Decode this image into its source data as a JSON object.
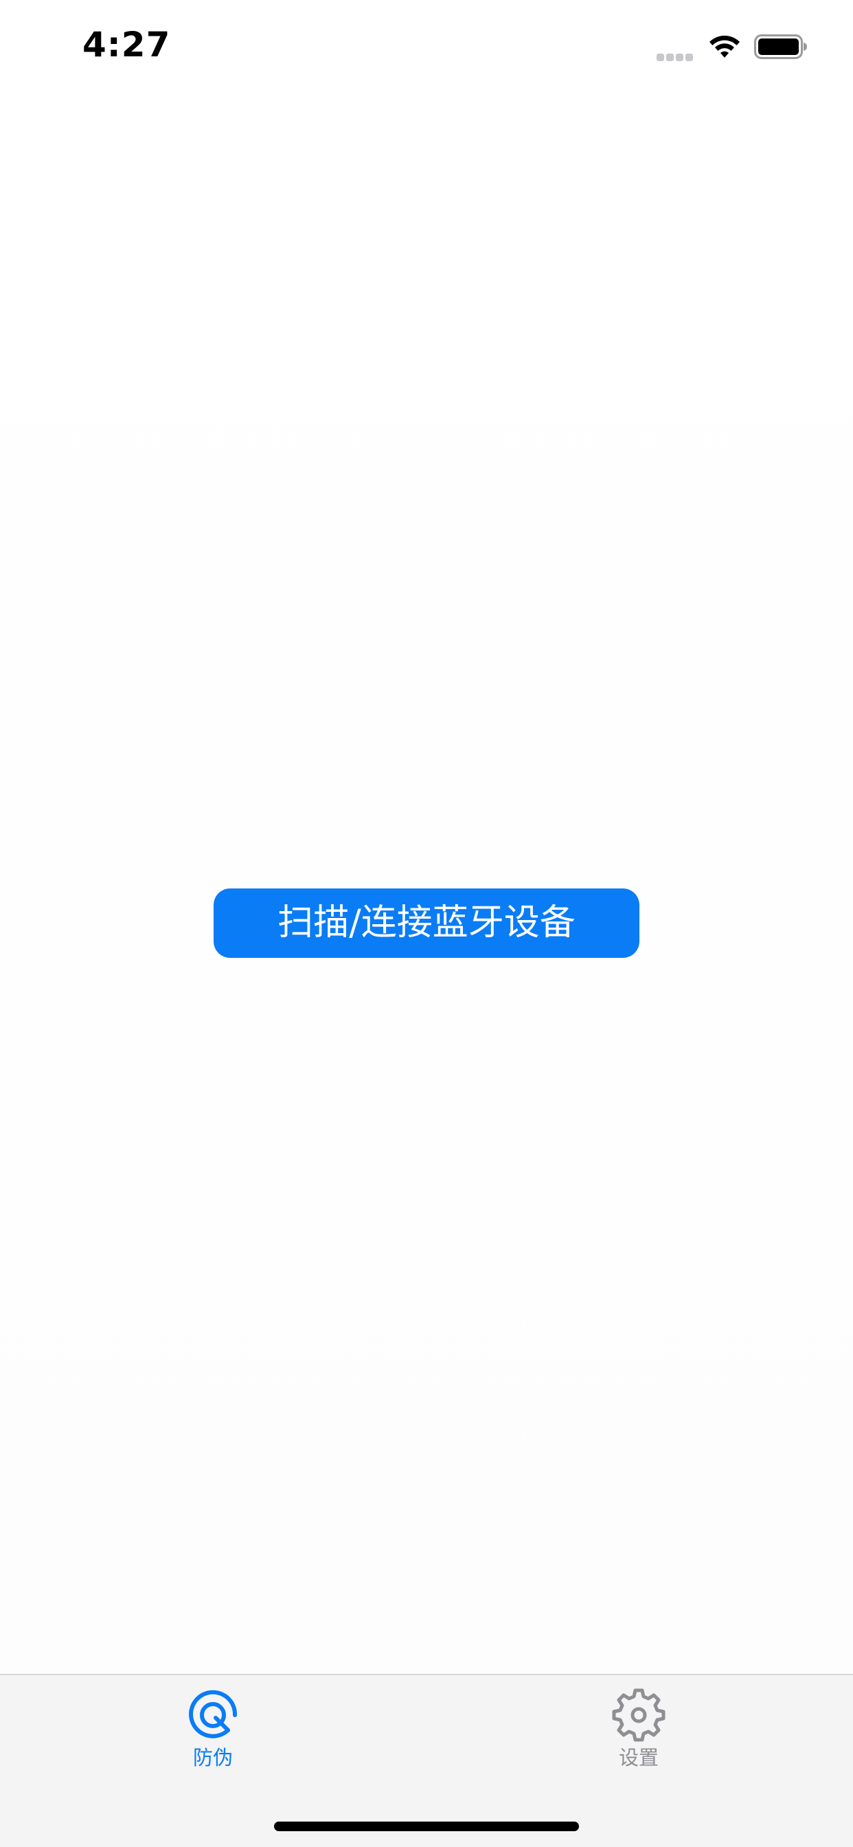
{
  "status_bar": {
    "time": "4:27",
    "wifi_icon": "wifi-icon",
    "battery_icon": "battery-icon",
    "signal_icon": "signal-dots-icon"
  },
  "main": {
    "scan_button_label": "扫描/连接蓝牙设备"
  },
  "tab_bar": {
    "tabs": [
      {
        "label": "防伪",
        "icon": "scan-target-icon",
        "active": true
      },
      {
        "label": "设置",
        "icon": "gear-icon",
        "active": false
      }
    ]
  },
  "colors": {
    "accent": "#0a7cf5",
    "tab_inactive": "#8e8e93",
    "tab_bar_background": "#f4f4f5"
  }
}
